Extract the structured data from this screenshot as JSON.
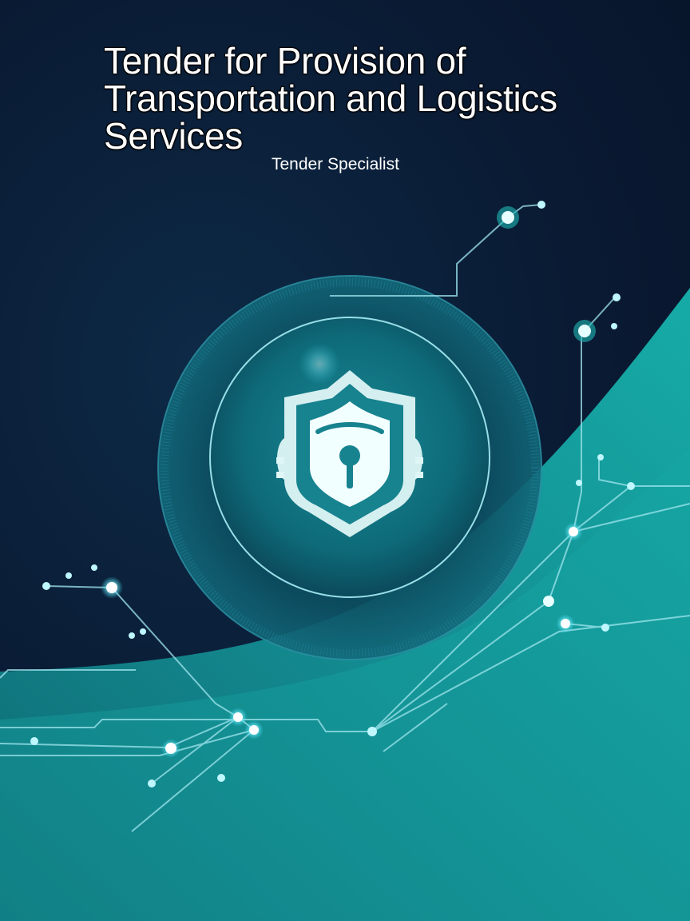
{
  "document": {
    "title": "Tender for Provision of Transportation and Logistics Services",
    "subtitle": "Tender Specialist"
  },
  "illustration": {
    "icon": "shield-keyhole-icon",
    "accent_color": "#1fb8b4",
    "glow_color": "#bff7ff",
    "background_color": "#0a1a33"
  }
}
